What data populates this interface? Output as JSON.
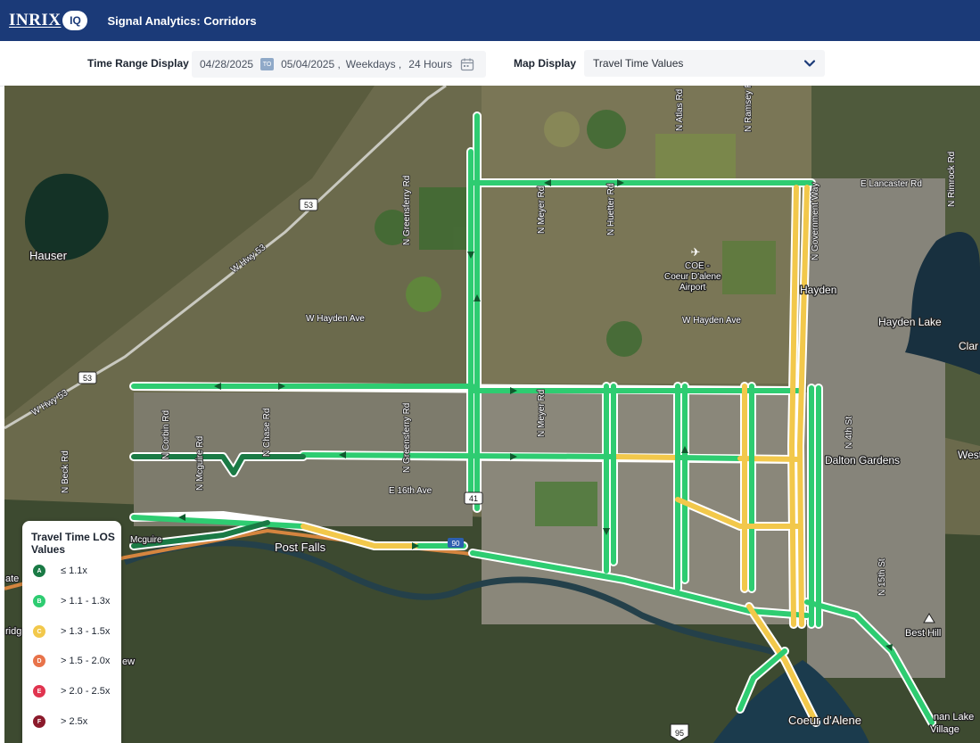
{
  "header": {
    "logo_text": "INRIX",
    "logo_badge": "IQ",
    "title": "Signal Analytics: Corridors"
  },
  "filters": {
    "time_range_label": "Time Range Display",
    "start_date": "04/28/2025",
    "to_badge": "TO",
    "end_date": "05/04/2025 ,",
    "days": "Weekdays ,",
    "hours": "24 Hours",
    "map_display_label": "Map Display",
    "map_display_value": "Travel Time Values"
  },
  "colors": {
    "header_bg": "#1b3a78",
    "los_a": "#1a7a45",
    "los_b": "#2ecc71",
    "los_c": "#f2c84b",
    "los_d": "#e8734a",
    "los_e": "#e0344f",
    "los_f": "#8b1a2b"
  },
  "legend": {
    "title": "Travel Time LOS Values",
    "items": [
      {
        "grade": "A",
        "label": "≤ 1.1x",
        "color": "#1a7a45"
      },
      {
        "grade": "B",
        "label": "> 1.1 - 1.3x",
        "color": "#2ecc71"
      },
      {
        "grade": "C",
        "label": "> 1.3 - 1.5x",
        "color": "#f2c84b"
      },
      {
        "grade": "D",
        "label": "> 1.5 - 2.0x",
        "color": "#e8734a"
      },
      {
        "grade": "E",
        "label": "> 2.0 - 2.5x",
        "color": "#e0344f"
      },
      {
        "grade": "F",
        "label": "> 2.5x",
        "color": "#8b1a2b"
      }
    ]
  },
  "map": {
    "places": {
      "hauser": "Hauser",
      "hayden": "Hayden",
      "hayden_lake": "Hayden Lake",
      "dalton_gardens": "Dalton Gardens",
      "post_falls": "Post Falls",
      "best_hill": "Best Hill",
      "coeur_dalene": "Coeur d'Alene",
      "airport_1": "COE -",
      "airport_2": "Coeur D'alene",
      "airport_3": "Airport",
      "clark": "Clar",
      "west": "West",
      "state": "ate",
      "ridge": "ridg",
      "view": "ew",
      "fernan": "nan Lake",
      "village": "Village",
      "mcguire_partial": "Mcguire"
    },
    "streets": {
      "lancaster": "E Lancaster Rd",
      "rimrock": "N Rimrock Rd",
      "hayden_ave_1": "W Hayden Ave",
      "hayden_ave_2": "W Hayden Ave",
      "e16th": "E 16th Ave",
      "greensferry_1": "N Greensferry Rd",
      "greensferry_2": "N Greensferry Rd",
      "meyer_1": "N Meyer Rd",
      "meyer_2": "N Meyer Rd",
      "huetter": "N Huetter Rd",
      "atlas": "N Atlas Rd",
      "ramsey": "N Ramsey Rd",
      "government_way": "N Government Way",
      "fourth": "N 4th St",
      "fifteenth": "N 15th St",
      "beck": "N Beck Rd",
      "corbin": "N Corbin Rd",
      "mcguire": "N Mcguire Rd",
      "chase": "N Chase Rd",
      "hwy53_1": "W Hwy 53",
      "hwy53_2": "W Hwy 53"
    },
    "shields": {
      "sh53_a": "53",
      "sh53_b": "53",
      "sh41": "41",
      "sh95": "95",
      "i90": "90"
    }
  }
}
